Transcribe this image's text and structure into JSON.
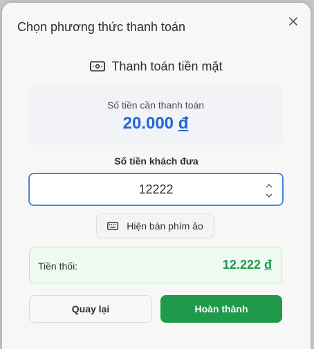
{
  "dialog": {
    "title": "Chọn phương thức thanh toán",
    "close_icon": "close-icon"
  },
  "method": {
    "icon": "cash-icon",
    "label": "Thanh toán tiền mặt"
  },
  "amount_due": {
    "label": "Số tiền cần thanh toán",
    "value": "20.000",
    "currency": "đ"
  },
  "cash_given": {
    "label": "Số tiền khách đưa",
    "value": "12222"
  },
  "keyboard_button": {
    "icon": "keyboard-icon",
    "label": "Hiện bàn phím ảo"
  },
  "change": {
    "label": "Tiền thối:",
    "value": "12.222",
    "currency": "đ"
  },
  "actions": {
    "back_label": "Quay lại",
    "done_label": "Hoàn thành"
  },
  "colors": {
    "accent_blue": "#2265d8",
    "success_green": "#1f9a4a",
    "input_border": "#4b83e0"
  }
}
